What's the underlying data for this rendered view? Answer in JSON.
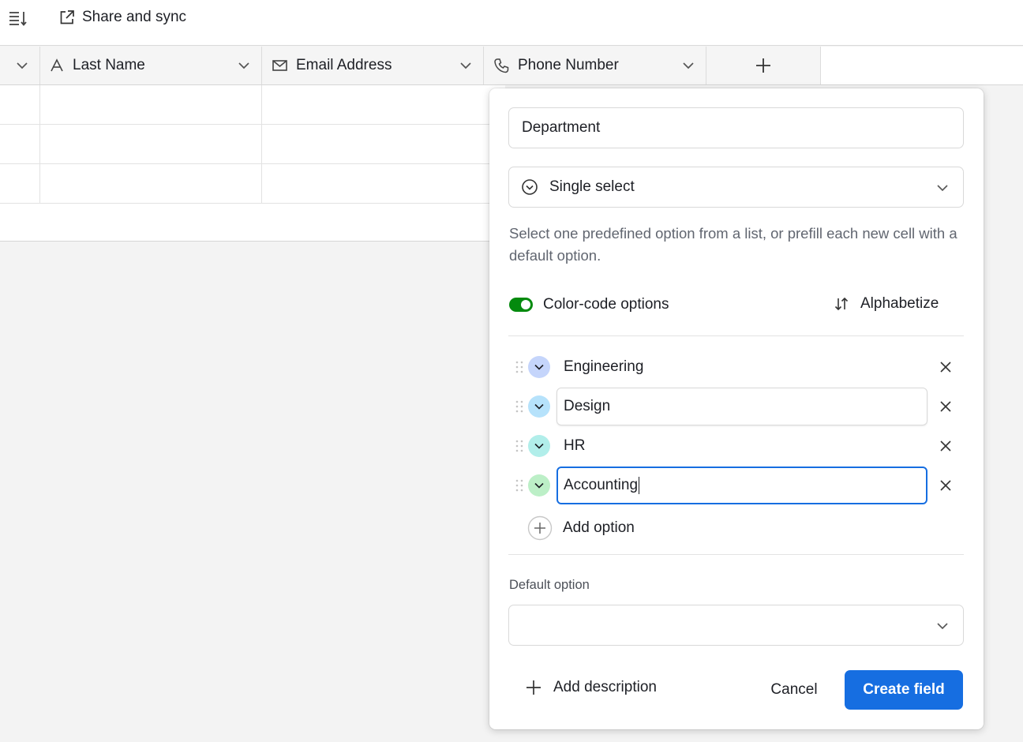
{
  "toolbar": {
    "menu_icon": "list-sort-icon",
    "share_icon": "external-link-icon",
    "share_label": "Share and sync"
  },
  "columns": [
    {
      "label": "",
      "icon": "none"
    },
    {
      "label": "Last Name",
      "icon": "text-icon"
    },
    {
      "label": "Email Address",
      "icon": "envelope-icon"
    },
    {
      "label": "Phone Number",
      "icon": "phone-icon"
    }
  ],
  "add_column_icon": "plus-icon",
  "field_editor": {
    "name_value": "Department",
    "type_label": "Single select",
    "type_icon": "single-select-icon",
    "description": "Select one predefined option from a list, or prefill each new cell with a default option.",
    "color_code_label": "Color-code options",
    "color_code_enabled": true,
    "alphabetize_label": "Alphabetize",
    "options": [
      {
        "label": "Engineering",
        "color": "#c5d5fb",
        "focused": false,
        "boxed": false
      },
      {
        "label": "Design",
        "color": "#b6e2fb",
        "focused": false,
        "boxed": true
      },
      {
        "label": "HR",
        "color": "#b1eeea",
        "focused": false,
        "boxed": false
      },
      {
        "label": "Accounting",
        "color": "#bcefc7",
        "focused": true,
        "boxed": false
      }
    ],
    "add_option_label": "Add option",
    "default_option_label": "Default option",
    "default_option_value": "",
    "add_description_label": "Add description",
    "cancel_label": "Cancel",
    "create_label": "Create field"
  },
  "colors": {
    "primary": "#166ee1",
    "toggle_on": "#048a0e"
  }
}
